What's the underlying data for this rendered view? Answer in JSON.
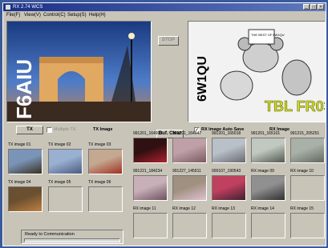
{
  "window": {
    "title": "RX 2.74 WCS"
  },
  "menu": [
    "File(F)",
    "View(V)",
    "Control(C)",
    "Setup(S)",
    "Help(H)"
  ],
  "tx_image": {
    "callsign": "F6AIU"
  },
  "rx_image": {
    "callsign": "6W1QU",
    "card_text": "THE BEST OF 6W1QU",
    "big_text": "TBL FR03"
  },
  "stop_label": "STOP",
  "tx_button": "TX",
  "multiple_tx": "Multiple TX",
  "tx_image_label": "TX Image",
  "buf_clear": "Buf. Clear",
  "rx_auto_save": "RX Image Auto Save",
  "rx_image_label": "RX Image",
  "tx_thumbs": [
    {
      "label": "TX image 01",
      "has_image": true,
      "c1": "#7a94b8",
      "c2": "#3a3020"
    },
    {
      "label": "TX image 02",
      "has_image": true,
      "c1": "#9ab0d0",
      "c2": "#4a5a80"
    },
    {
      "label": "TX image 03",
      "has_image": true,
      "c1": "#c4a890",
      "c2": "#a03020"
    },
    {
      "label": "TX image 04",
      "has_image": true,
      "c1": "#6a5030",
      "c2": "#c08040"
    },
    {
      "label": "TX image 05",
      "has_image": false
    },
    {
      "label": "TX image 06",
      "has_image": false
    }
  ],
  "rx_thumbs": [
    {
      "label": "991201_164913",
      "has_image": true,
      "c1": "#301010",
      "c2": "#b02030"
    },
    {
      "label": "991201_164947",
      "has_image": true,
      "c1": "#c0a0a8",
      "c2": "#7a5a60"
    },
    {
      "label": "991201_165018",
      "has_image": true,
      "c1": "#b8c0c8",
      "c2": "#6a6a70"
    },
    {
      "label": "991201_165101",
      "has_image": true,
      "c1": "#c0c8c0",
      "c2": "#505850"
    },
    {
      "label": "991215_205251",
      "has_image": true,
      "c1": "#a8b0a8",
      "c2": "#606860"
    },
    {
      "label": "991221_184234",
      "has_image": true,
      "c1": "#c8b0b8",
      "c2": "#705060"
    },
    {
      "label": "991227_145911",
      "has_image": true,
      "c1": "#a09080",
      "c2": "#e0c0d0"
    },
    {
      "label": "000107_190543",
      "has_image": true,
      "c1": "#c04060",
      "c2": "#402030"
    },
    {
      "label": "RX image 09",
      "has_image": true,
      "c1": "#909090",
      "c2": "#303030"
    },
    {
      "label": "RX image 10",
      "has_image": false
    },
    {
      "label": "RX image 11",
      "has_image": false
    },
    {
      "label": "RX image 12",
      "has_image": false
    },
    {
      "label": "RX image 13",
      "has_image": false
    },
    {
      "label": "RX image 14",
      "has_image": false
    },
    {
      "label": "RX image 15",
      "has_image": false
    }
  ],
  "status": {
    "text": "Ready to Communication"
  },
  "colors": {
    "desktop": "#3a5a9a",
    "title_start": "#1b2f86",
    "title_end": "#5f7ac0",
    "face": "#c8c4b8"
  }
}
